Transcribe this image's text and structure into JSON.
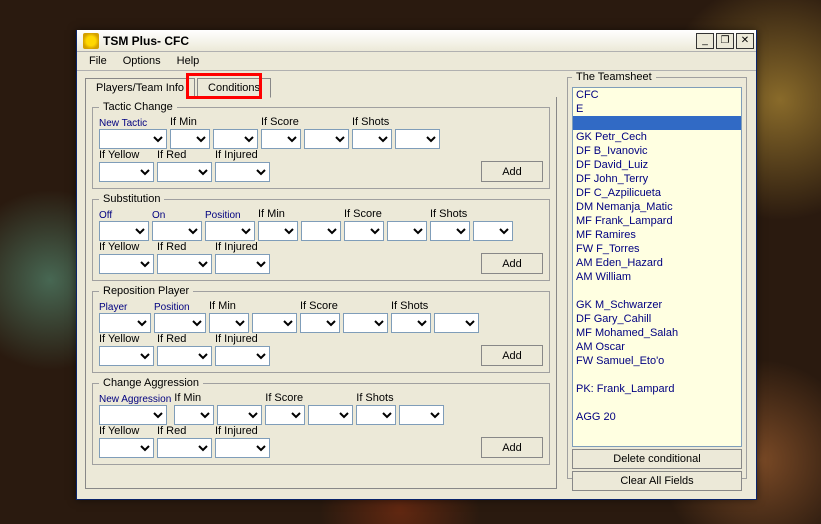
{
  "window": {
    "title": "TSM Plus- CFC",
    "min": "_",
    "restore": "❐",
    "close": "✕"
  },
  "menu": {
    "file": "File",
    "options": "Options",
    "help": "Help"
  },
  "tabs": {
    "players": "Players/Team Info",
    "conditions": "Conditions"
  },
  "labels": {
    "tacticChange": "Tactic Change",
    "newTactic": "New Tactic",
    "ifMin": "If Min",
    "ifScore": "If Score",
    "ifShots": "If Shots",
    "ifYellow": "If Yellow",
    "ifRed": "If Red",
    "ifInjured": "If Injured",
    "add": "Add",
    "substitution": "Substitution",
    "off": "Off",
    "on": "On",
    "position": "Position",
    "reposition": "Reposition Player",
    "player": "Player",
    "changeAggression": "Change Aggression",
    "newAggression": "New Aggression",
    "teamsheet": "The Teamsheet",
    "deleteCond": "Delete conditional",
    "clearAll": "Clear All Fields"
  },
  "teamsheet": [
    {
      "t": "CFC",
      "sel": false
    },
    {
      "t": "E",
      "sel": false
    },
    {
      "t": "",
      "sel": true
    },
    {
      "t": "GK Petr_Cech",
      "sel": false
    },
    {
      "t": "DF B_Ivanovic",
      "sel": false
    },
    {
      "t": "DF David_Luiz",
      "sel": false
    },
    {
      "t": "DF John_Terry",
      "sel": false
    },
    {
      "t": "DF C_Azpilicueta",
      "sel": false
    },
    {
      "t": "DM Nemanja_Matic",
      "sel": false
    },
    {
      "t": "MF Frank_Lampard",
      "sel": false
    },
    {
      "t": "MF Ramires",
      "sel": false
    },
    {
      "t": "FW F_Torres",
      "sel": false
    },
    {
      "t": "AM Eden_Hazard",
      "sel": false
    },
    {
      "t": "AM William",
      "sel": false
    },
    {
      "t": "",
      "sel": false
    },
    {
      "t": "GK M_Schwarzer",
      "sel": false
    },
    {
      "t": "DF Gary_Cahill",
      "sel": false
    },
    {
      "t": "MF Mohamed_Salah",
      "sel": false
    },
    {
      "t": "AM Oscar",
      "sel": false
    },
    {
      "t": "FW Samuel_Eto'o",
      "sel": false
    },
    {
      "t": "",
      "sel": false
    },
    {
      "t": "PK: Frank_Lampard",
      "sel": false
    },
    {
      "t": "",
      "sel": false
    },
    {
      "t": "AGG 20",
      "sel": false
    }
  ]
}
